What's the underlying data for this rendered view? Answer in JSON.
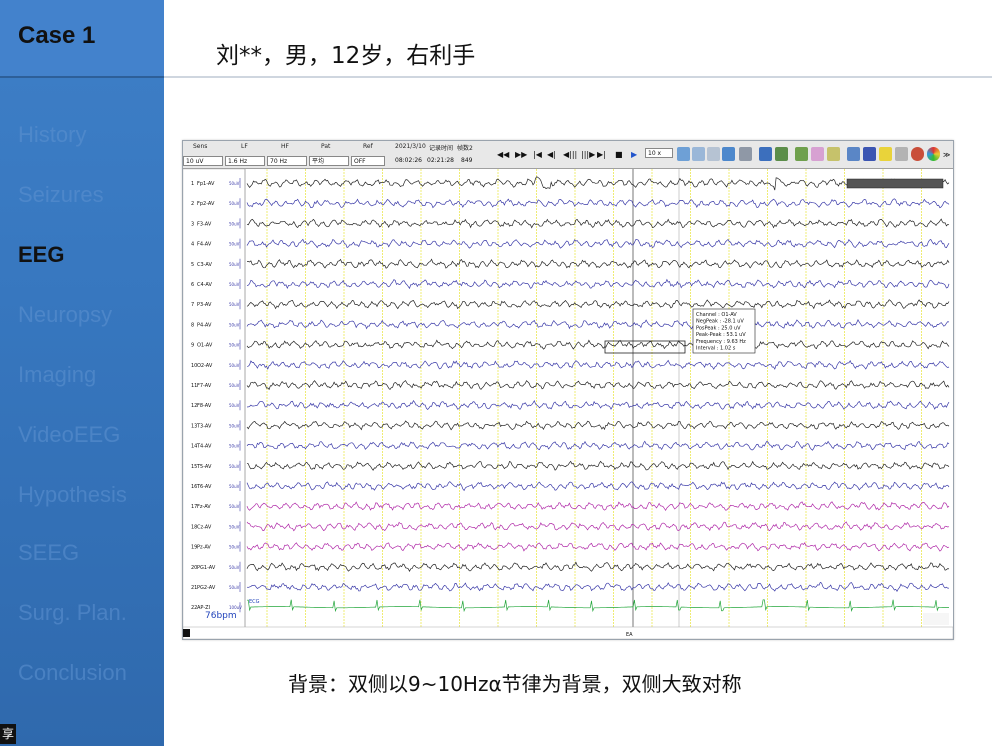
{
  "slide": {
    "case_label": "Case 1",
    "title": "刘**，男，12岁，右利手",
    "caption": "背景：双侧以9~10Hzα节律为背景，双侧大致对称"
  },
  "sidebar": {
    "items": [
      {
        "label": "History",
        "active": false
      },
      {
        "label": "Seizures",
        "active": false
      },
      {
        "label": "EEG",
        "active": true
      },
      {
        "label": "Neuropsy",
        "active": false
      },
      {
        "label": "Imaging",
        "active": false
      },
      {
        "label": "VideoEEG",
        "active": false
      },
      {
        "label": "Hypothesis",
        "active": false
      },
      {
        "label": "SEEG",
        "active": false
      },
      {
        "label": "Surg. Plan.",
        "active": false
      },
      {
        "label": "Conclusion",
        "active": false
      }
    ],
    "corner_glyph": "享"
  },
  "eeg": {
    "toolbar": {
      "sens_label": "Sens",
      "sens_value": "10 uV",
      "lf_label": "LF",
      "lf_value": "1.6 Hz",
      "hf_label": "HF",
      "hf_value": "70 Hz",
      "pat_label": "Pat",
      "pat_value": "平均",
      "ref_label": "Ref",
      "ref_value": "OFF",
      "date": "2021/3/10",
      "rec_label": "记录时间",
      "frame_label": "帧数2",
      "time1": "08:02:26",
      "time2": "02:21:28",
      "frames": "849",
      "speed": "10 x"
    },
    "channels": [
      {
        "num": "1",
        "name": "Fp1-AV",
        "color": "#222222"
      },
      {
        "num": "2",
        "name": "Fp2-AV",
        "color": "#3a3aa8"
      },
      {
        "num": "3",
        "name": "F3-AV",
        "color": "#222222"
      },
      {
        "num": "4",
        "name": "F4-AV",
        "color": "#3a3aa8"
      },
      {
        "num": "5",
        "name": "C3-AV",
        "color": "#222222"
      },
      {
        "num": "6",
        "name": "C4-AV",
        "color": "#3a3aa8"
      },
      {
        "num": "7",
        "name": "P3-AV",
        "color": "#222222"
      },
      {
        "num": "8",
        "name": "P4-AV",
        "color": "#3a3aa8"
      },
      {
        "num": "9",
        "name": "O1-AV",
        "color": "#222222"
      },
      {
        "num": "10",
        "name": "O2-AV",
        "color": "#3a3aa8"
      },
      {
        "num": "11",
        "name": "F7-AV",
        "color": "#222222"
      },
      {
        "num": "12",
        "name": "F8-AV",
        "color": "#3a3aa8"
      },
      {
        "num": "13",
        "name": "T3-AV",
        "color": "#222222"
      },
      {
        "num": "14",
        "name": "T4-AV",
        "color": "#3a3aa8"
      },
      {
        "num": "15",
        "name": "T5-AV",
        "color": "#222222"
      },
      {
        "num": "16",
        "name": "T6-AV",
        "color": "#3a3aa8"
      },
      {
        "num": "17",
        "name": "Fz-AV",
        "color": "#b02aa8"
      },
      {
        "num": "18",
        "name": "Cz-AV",
        "color": "#b02aa8"
      },
      {
        "num": "19",
        "name": "Pz-AV",
        "color": "#b02aa8"
      },
      {
        "num": "20",
        "name": "PG1-AV",
        "color": "#222222"
      },
      {
        "num": "21",
        "name": "PG2-AV",
        "color": "#3a3aa8"
      },
      {
        "num": "22",
        "name": "AP-ZI",
        "color": "#22a63a"
      }
    ],
    "scale_unit": "50uV",
    "ecg_scale": "100uV",
    "ecg_label": "ECG",
    "bpm": "76bpm",
    "event_marker": "EA",
    "measurement": {
      "channel": "Channel : O1-AV",
      "negpeak": "NegPeak : -28.1 uV",
      "pospeak": "PosPeak : 25.0 uV",
      "peakpeak": "Peak-Peak : 53.1 uV",
      "frequency": "Frequency : 9.63 Hz",
      "interval": "Interval : 1.02 s"
    },
    "colors": {
      "grid": "#e8e43a",
      "cursor": "#555555",
      "ecg": "#22a63a"
    }
  }
}
